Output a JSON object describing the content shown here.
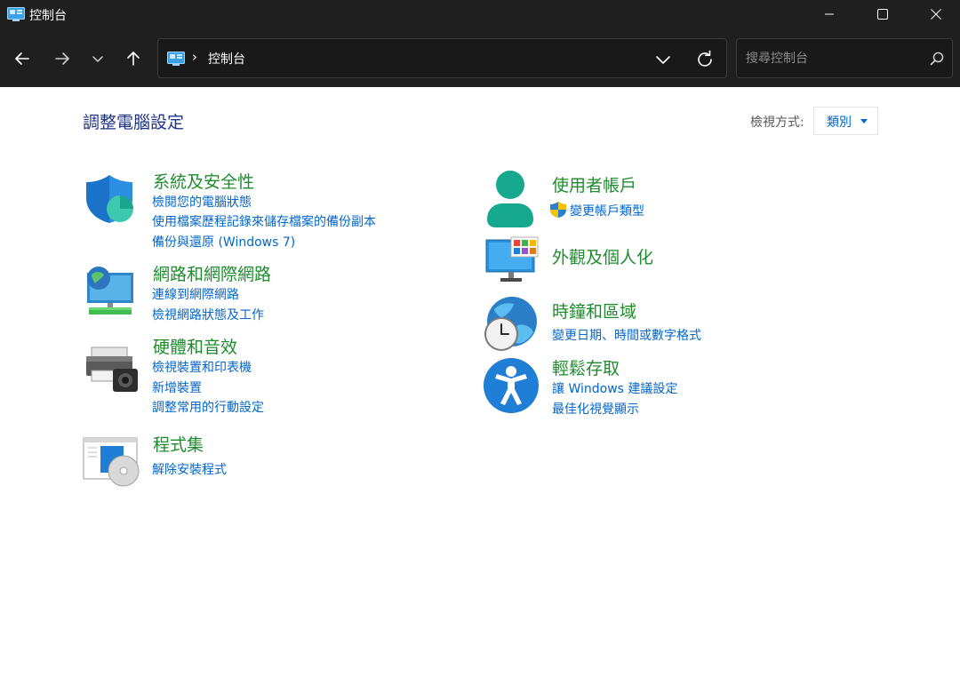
{
  "window": {
    "title": "控制台"
  },
  "nav": {
    "breadcrumb": "控制台",
    "breadcrumb_sep": "›",
    "search_placeholder": "搜尋控制台"
  },
  "main": {
    "heading": "調整電腦設定",
    "view_by_label": "檢視方式:",
    "view_by_value": "類別"
  },
  "categories": {
    "system": {
      "title": "系統及安全性",
      "links": [
        "檢閱您的電腦狀態",
        "使用檔案歷程記錄來儲存檔案的備份副本",
        "備份與還原 (Windows 7)"
      ]
    },
    "network": {
      "title": "網路和網際網路",
      "links": [
        "連線到網際網路",
        "檢視網路狀態及工作"
      ]
    },
    "hardware": {
      "title": "硬體和音效",
      "links": [
        "檢視裝置和印表機",
        "新增裝置",
        "調整常用的行動設定"
      ]
    },
    "programs": {
      "title": "程式集",
      "links": [
        "解除安裝程式"
      ]
    },
    "users": {
      "title": "使用者帳戶",
      "links": [
        "變更帳戶類型"
      ]
    },
    "appearance": {
      "title": "外觀及個人化",
      "links": []
    },
    "clock": {
      "title": "時鐘和區域",
      "links": [
        "變更日期、時間或數字格式"
      ]
    },
    "ease": {
      "title": "輕鬆存取",
      "links": [
        "讓 Windows 建議設定",
        "最佳化視覺顯示"
      ]
    }
  },
  "colors": {
    "chrome": "#1f1f1f",
    "heading": "#1e3287",
    "category_title": "#1e8c2e",
    "link": "#0066cc"
  }
}
